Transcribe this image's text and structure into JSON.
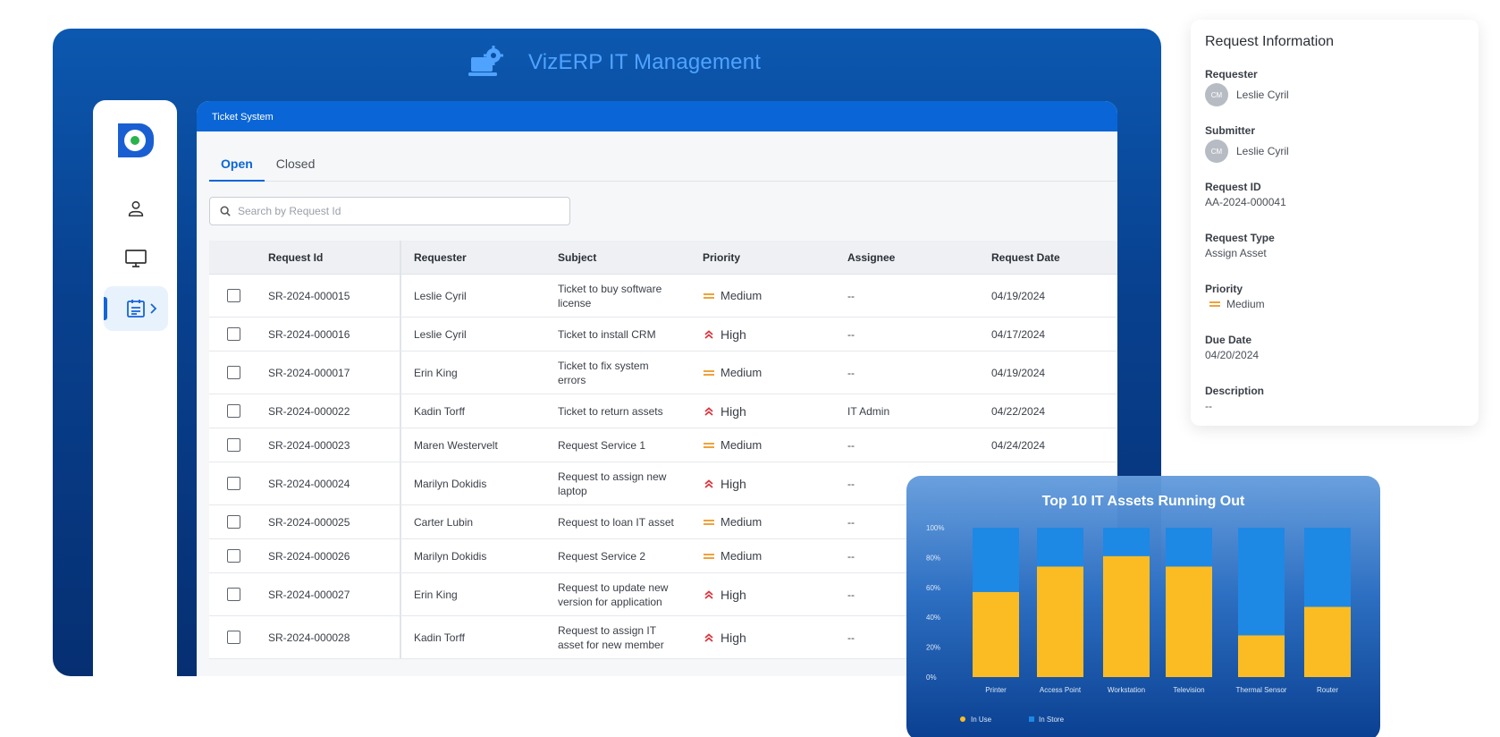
{
  "app": {
    "title": "VizERP IT Management"
  },
  "content": {
    "header": "Ticket System",
    "tabs": [
      {
        "label": "Open",
        "active": true
      },
      {
        "label": "Closed",
        "active": false
      }
    ],
    "search": {
      "placeholder": "Search by Request Id",
      "value": ""
    },
    "columns": [
      "Request Id",
      "Requester",
      "Subject",
      "Priority",
      "Assignee",
      "Request Date"
    ],
    "rows": [
      {
        "id": "SR-2024-000015",
        "requester": "Leslie Cyril",
        "subject": "Ticket to buy software license",
        "priority": "Medium",
        "assignee": "--",
        "date": "04/19/2024"
      },
      {
        "id": "SR-2024-000016",
        "requester": "Leslie Cyril",
        "subject": "Ticket to install CRM",
        "priority": "High",
        "assignee": "--",
        "date": "04/17/2024"
      },
      {
        "id": "SR-2024-000017",
        "requester": "Erin King",
        "subject": "Ticket to fix system errors",
        "priority": "Medium",
        "assignee": "--",
        "date": "04/19/2024"
      },
      {
        "id": "SR-2024-000022",
        "requester": "Kadin Torff",
        "subject": "Ticket to return assets",
        "priority": "High",
        "assignee": "IT Admin",
        "date": "04/22/2024"
      },
      {
        "id": "SR-2024-000023",
        "requester": "Maren Westervelt",
        "subject": "Request Service 1",
        "priority": "Medium",
        "assignee": "--",
        "date": "04/24/2024"
      },
      {
        "id": "SR-2024-000024",
        "requester": "Marilyn Dokidis",
        "subject": "Request to assign new laptop",
        "priority": "High",
        "assignee": "--",
        "date": ""
      },
      {
        "id": "SR-2024-000025",
        "requester": "Carter Lubin",
        "subject": "Request to loan IT asset",
        "priority": "Medium",
        "assignee": "--",
        "date": ""
      },
      {
        "id": "SR-2024-000026",
        "requester": "Marilyn Dokidis",
        "subject": "Request Service 2",
        "priority": "Medium",
        "assignee": "--",
        "date": ""
      },
      {
        "id": "SR-2024-000027",
        "requester": "Erin King",
        "subject": "Request to update new version for application",
        "priority": "High",
        "assignee": "--",
        "date": ""
      },
      {
        "id": "SR-2024-000028",
        "requester": "Kadin Torff",
        "subject": "Request to assign IT asset for new member",
        "priority": "High",
        "assignee": "--",
        "date": ""
      }
    ]
  },
  "info": {
    "title": "Request Information",
    "requester_label": "Requester",
    "requester": "Leslie Cyril",
    "requester_initials": "CM",
    "submitter_label": "Submitter",
    "submitter": "Leslie Cyril",
    "submitter_initials": "CM",
    "request_id_label": "Request ID",
    "request_id": "AA-2024-000041",
    "request_type_label": "Request Type",
    "request_type": "Assign Asset",
    "priority_label": "Priority",
    "priority": "Medium",
    "due_date_label": "Due Date",
    "due_date": "04/20/2024",
    "description_label": "Description",
    "description": "--"
  },
  "colors": {
    "primary": "#0a66d6",
    "in_use": "#fbbc23",
    "in_store": "#1e88e5",
    "high": "#d9363e",
    "medium": "#f0a23a"
  },
  "chart_data": {
    "type": "bar",
    "stacked": true,
    "title": "Top 10 IT Assets Running Out",
    "categories": [
      "Printer",
      "Access Point",
      "Workstation",
      "Television",
      "Thermal Sensor",
      "Router"
    ],
    "series": [
      {
        "name": "In Use",
        "values": [
          57,
          74,
          81,
          74,
          28,
          47
        ]
      },
      {
        "name": "In Store",
        "values": [
          43,
          26,
          19,
          26,
          72,
          53
        ]
      }
    ],
    "yticks": [
      "0%",
      "20%",
      "40%",
      "60%",
      "80%",
      "100%"
    ],
    "ylim": [
      0,
      100
    ],
    "legend": "bottom-left"
  }
}
